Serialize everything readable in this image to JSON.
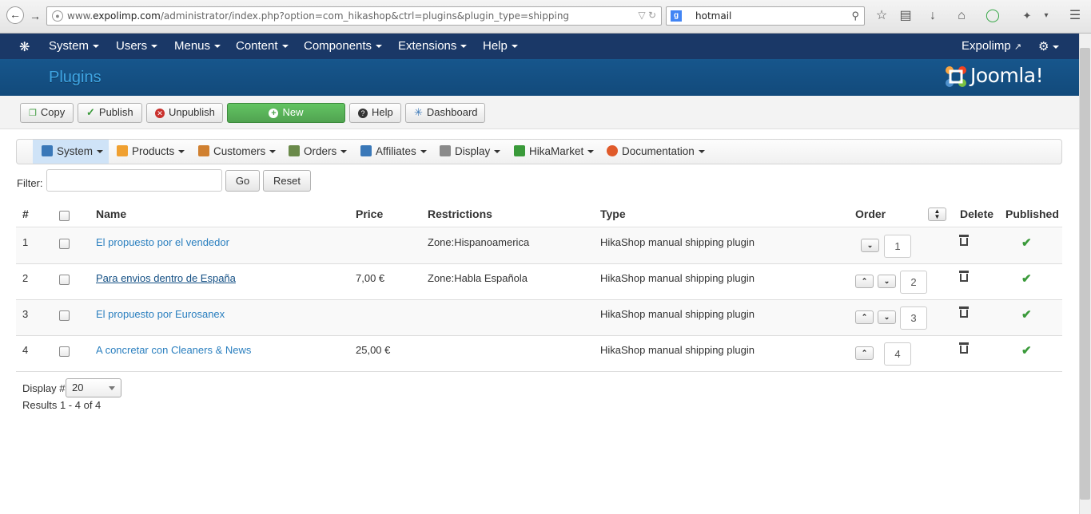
{
  "browser": {
    "url_prefix": "www.",
    "url_domain": "expolimp.com",
    "url_rest": "/administrator/index.php?option=com_hikashop&ctrl=plugins&plugin_type=shipping",
    "search_value": "hotmail"
  },
  "topnav": {
    "items": [
      {
        "label": "System"
      },
      {
        "label": "Users"
      },
      {
        "label": "Menus"
      },
      {
        "label": "Content"
      },
      {
        "label": "Components"
      },
      {
        "label": "Extensions"
      },
      {
        "label": "Help"
      }
    ],
    "site_label": "Expolimp"
  },
  "header": {
    "title": "Plugins",
    "brand": "Joomla!"
  },
  "toolbar": {
    "copy": "Copy",
    "publish": "Publish",
    "unpublish": "Unpublish",
    "new": "New",
    "help": "Help",
    "dashboard": "Dashboard"
  },
  "hikamenu": {
    "items": [
      {
        "label": "System",
        "icon": "wrench-icon",
        "color": "#3a78b8"
      },
      {
        "label": "Products",
        "icon": "box-icon",
        "color": "#f0a030"
      },
      {
        "label": "Customers",
        "icon": "users-icon",
        "color": "#d08030"
      },
      {
        "label": "Orders",
        "icon": "orders-icon",
        "color": "#6a8a4a"
      },
      {
        "label": "Affiliates",
        "icon": "affiliates-icon",
        "color": "#3a78b8"
      },
      {
        "label": "Display",
        "icon": "display-icon",
        "color": "#8a8a8a"
      },
      {
        "label": "HikaMarket",
        "icon": "hikamarket-icon",
        "color": "#3a9a3a"
      },
      {
        "label": "Documentation",
        "icon": "lifebuoy-icon",
        "color": "#e05a2a"
      }
    ]
  },
  "filter": {
    "label": "Filter:",
    "value": "",
    "go": "Go",
    "reset": "Reset"
  },
  "table": {
    "headers": {
      "num": "#",
      "name": "Name",
      "price": "Price",
      "restrictions": "Restrictions",
      "type": "Type",
      "order": "Order",
      "delete": "Delete",
      "published": "Published"
    },
    "rows": [
      {
        "num": "1",
        "name": "El propuesto por el vendedor",
        "price": "",
        "restrictions": "Zone:Hispanoamerica",
        "type": "HikaShop manual shipping plugin",
        "order": "1",
        "published": true
      },
      {
        "num": "2",
        "name": "Para envios dentro de España",
        "price": "7,00 €",
        "restrictions": "Zone:Habla Española",
        "type": "HikaShop manual shipping plugin",
        "order": "2",
        "published": true
      },
      {
        "num": "3",
        "name": "El propuesto por Eurosanex",
        "price": "",
        "restrictions": "",
        "type": "HikaShop manual shipping plugin",
        "order": "3",
        "published": true
      },
      {
        "num": "4",
        "name": "A concretar con Cleaners & News",
        "price": "25,00 €",
        "restrictions": "",
        "type": "HikaShop manual shipping plugin",
        "order": "4",
        "published": true
      }
    ]
  },
  "footer": {
    "display_label": "Display #",
    "limit": "20",
    "results": "Results 1 - 4 of 4"
  },
  "colors": {
    "navbar": "#1a3867",
    "header": "#17568c",
    "title": "#3fa5e3",
    "link": "#2a7fbf",
    "green": "#51a351"
  }
}
